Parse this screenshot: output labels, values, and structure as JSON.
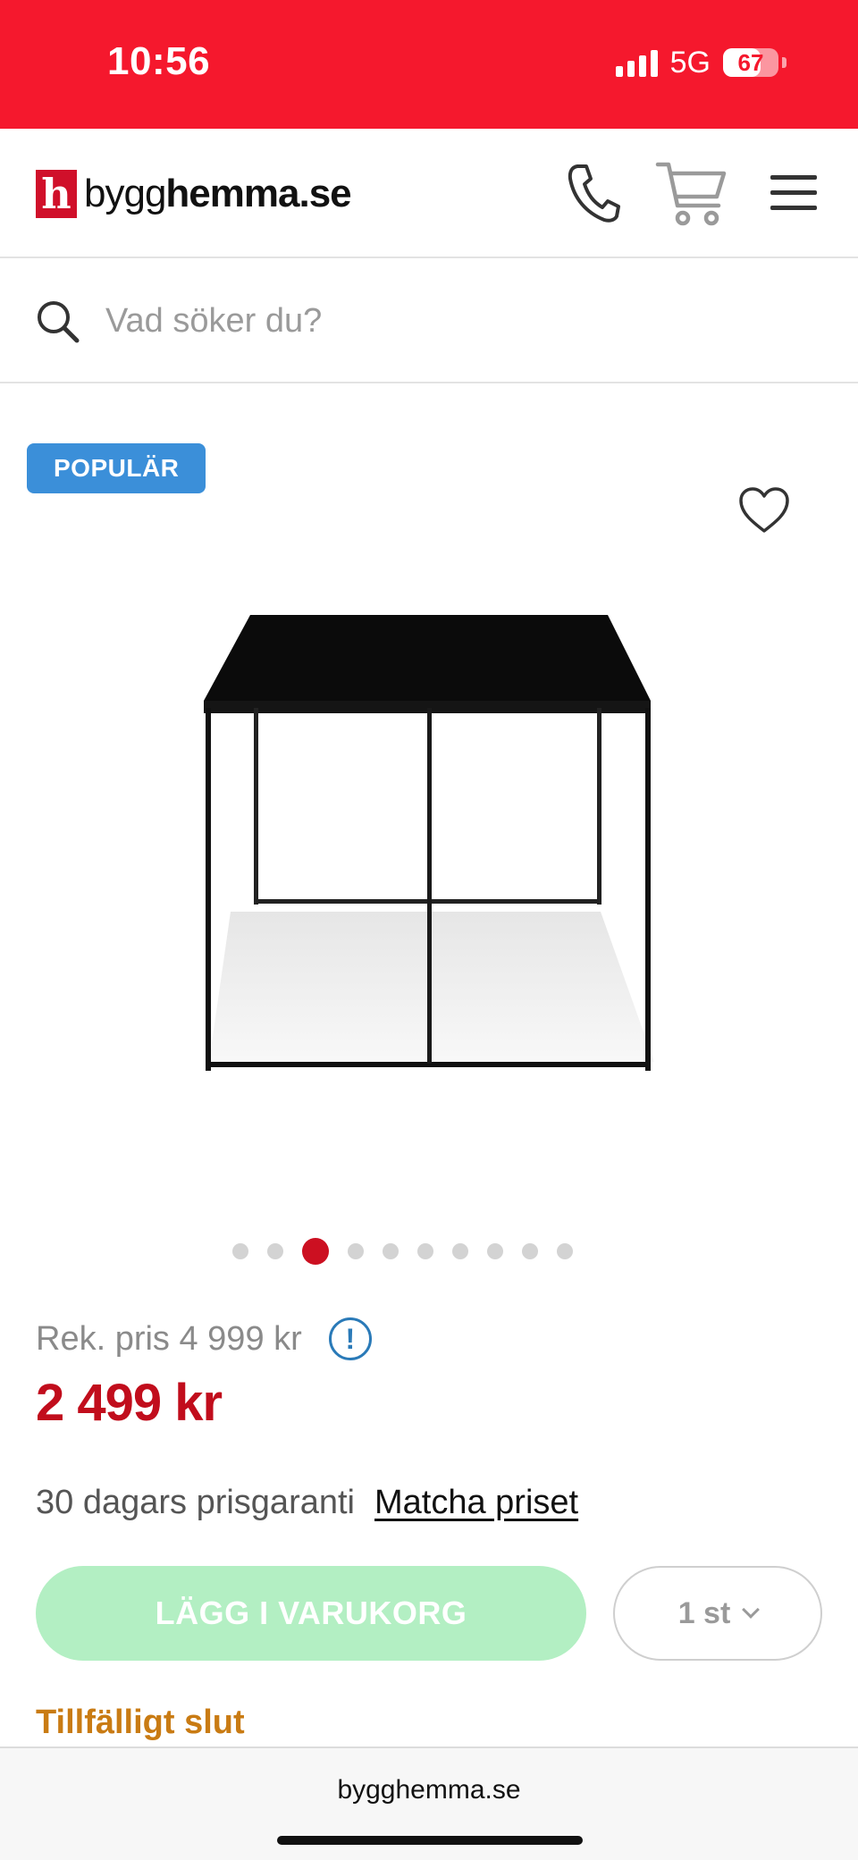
{
  "status_bar": {
    "time": "10:56",
    "network": "5G",
    "battery": "67",
    "battery_level": 0.67,
    "accent": "#f5182d"
  },
  "header": {
    "logo_mark": "h",
    "logo_prefix": "bygg",
    "logo_suffix": "hemma.se",
    "icons": [
      "phone-icon",
      "cart-icon",
      "menu-icon"
    ]
  },
  "search": {
    "placeholder": "Vad söker du?"
  },
  "product": {
    "badge": "POPULÄR",
    "badge_color": "#3b8fd9",
    "gallery": {
      "total": 10,
      "active_index": 2
    },
    "rek_price": "Rek. pris 4 999 kr",
    "info_symbol": "!",
    "price": "2 499 kr",
    "price_color": "#c10d1c",
    "guarantee_text": "30 dagars prisgaranti",
    "match_link": "Matcha priset",
    "add_to_cart_label": "LÄGG I VARUKORG",
    "quantity": "1 st",
    "stock_status": "Tillfälligt slut",
    "stock_color": "#c97b13"
  },
  "browser": {
    "url": "bygghemma.se"
  }
}
